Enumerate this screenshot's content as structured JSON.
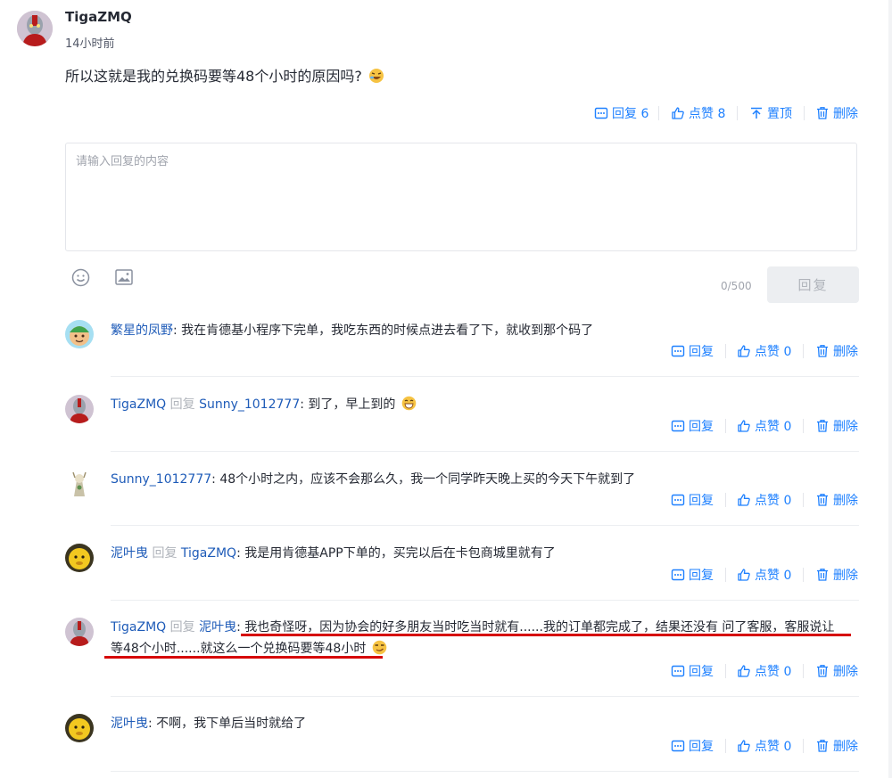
{
  "post": {
    "author": "TigaZMQ",
    "time": "14小时前",
    "text": "所以这就是我的兑换码要等48个小时的原因吗?",
    "actions": {
      "reply": "回复 6",
      "like": "点赞 8",
      "pin": "置顶",
      "delete": "删除"
    }
  },
  "reply_box": {
    "placeholder": "请输入回复的内容",
    "counter": "0/500",
    "submit": "回复"
  },
  "replies": [
    {
      "user": "繁星的凤野",
      "text": ": 我在肯德基小程序下完单，我吃东西的时候点进去看了下，就收到那个码了",
      "reply": "回复",
      "like": "点赞 0",
      "delete": "删除"
    },
    {
      "user": "TigaZMQ",
      "mid": "回复",
      "target": "Sunny_1012777",
      "text": ": 到了，早上到的",
      "reply": "回复",
      "like": "点赞 0",
      "delete": "删除"
    },
    {
      "user": "Sunny_1012777",
      "text": ": 48个小时之内，应该不会那么久，我一个同学昨天晚上买的今天下午就到了",
      "reply": "回复",
      "like": "点赞 0",
      "delete": "删除"
    },
    {
      "user": "泥叶曳",
      "mid": "回复",
      "target": "TigaZMQ",
      "text": ": 我是用肯德基APP下单的，买完以后在卡包商城里就有了",
      "reply": "回复",
      "like": "点赞 0",
      "delete": "删除"
    },
    {
      "user": "TigaZMQ",
      "mid": "回复",
      "target": "泥叶曳",
      "text": ": 我也奇怪呀，因为协会的好多朋友当时吃当时就有......我的订单都完成了，结果还没有 问了客服，客服说让",
      "text2": "等48个小时......就这么一个兑换码要等48小时",
      "reply": "回复",
      "like": "点赞 0",
      "delete": "删除"
    },
    {
      "user": "泥叶曳",
      "text": ": 不啊，我下单后当时就给了",
      "reply": "回复",
      "like": "点赞 0",
      "delete": "删除"
    }
  ]
}
